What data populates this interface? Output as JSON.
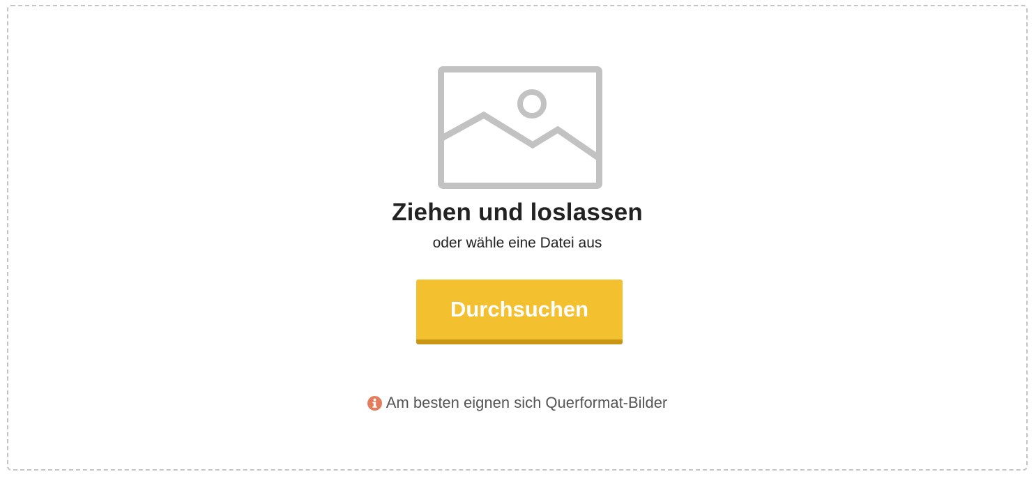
{
  "dropzone": {
    "image_icon": "image-placeholder-icon",
    "title": "Ziehen und loslassen",
    "subtitle": "oder wähle eine Datei aus",
    "browse_label": "Durchsuchen",
    "hint_icon": "info-icon",
    "hint_text": "Am besten eignen sich Querformat-Bilder"
  },
  "colors": {
    "button": "#f3c030",
    "button_shadow": "#c99514",
    "icon_gray": "#c2c2c2",
    "info_icon": "#e37d5c",
    "border": "#c4c4c4"
  }
}
